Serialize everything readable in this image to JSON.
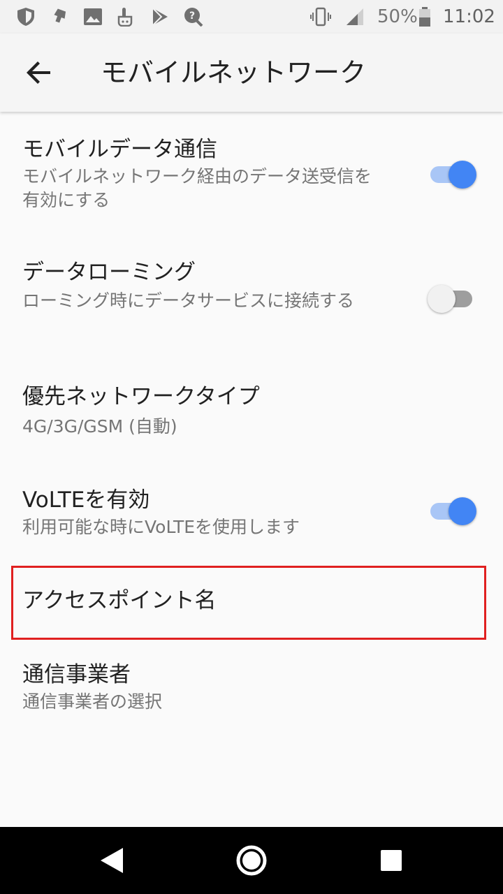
{
  "status_bar": {
    "icons_left": [
      "shield-icon",
      "download-icon",
      "image-icon",
      "touch-icon",
      "play-store-icon",
      "settings-search-icon"
    ],
    "icons_right": [
      "vibrate-icon",
      "signal-icon",
      "battery-icon"
    ],
    "battery": "50%",
    "time": "11:02"
  },
  "app_bar": {
    "back_icon": "arrow-back-icon",
    "title": "モバイルネットワーク"
  },
  "settings": [
    {
      "title": "モバイルデータ通信",
      "summary": "モバイルネットワーク経由のデータ送受信を有効にする",
      "switch": "on"
    },
    {
      "title": "データローミング",
      "summary": "ローミング時にデータサービスに接続する",
      "switch": "off"
    },
    {
      "title": "優先ネットワークタイプ",
      "summary": "4G/3G/GSM (自動)"
    },
    {
      "title": "VoLTEを有効",
      "summary": "利用可能な時にVoLTEを使用します",
      "switch": "on"
    },
    {
      "title": "アクセスポイント名"
    },
    {
      "title": "通信事業者",
      "summary": "通信事業者の選択"
    }
  ],
  "nav_bar": {
    "icons": [
      "back-triangle-icon",
      "home-circle-icon",
      "recents-square-icon"
    ]
  },
  "colors": {
    "accent": "#4285f4",
    "highlight": "#e02020"
  }
}
